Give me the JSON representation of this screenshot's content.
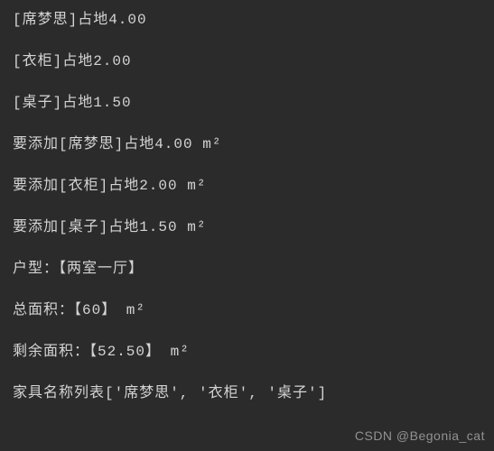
{
  "console": {
    "lines": [
      "[席梦思]占地4.00",
      "[衣柜]占地2.00",
      "[桌子]占地1.50",
      "要添加[席梦思]占地4.00 m²",
      "要添加[衣柜]占地2.00 m²",
      "要添加[桌子]占地1.50 m²",
      "户型：【两室一厅】",
      "总面积：【60】 m²",
      "剩余面积：【52.50】 m²",
      "家具名称列表['席梦思', '衣柜', '桌子']"
    ]
  },
  "watermark": "CSDN @Begonia_cat"
}
